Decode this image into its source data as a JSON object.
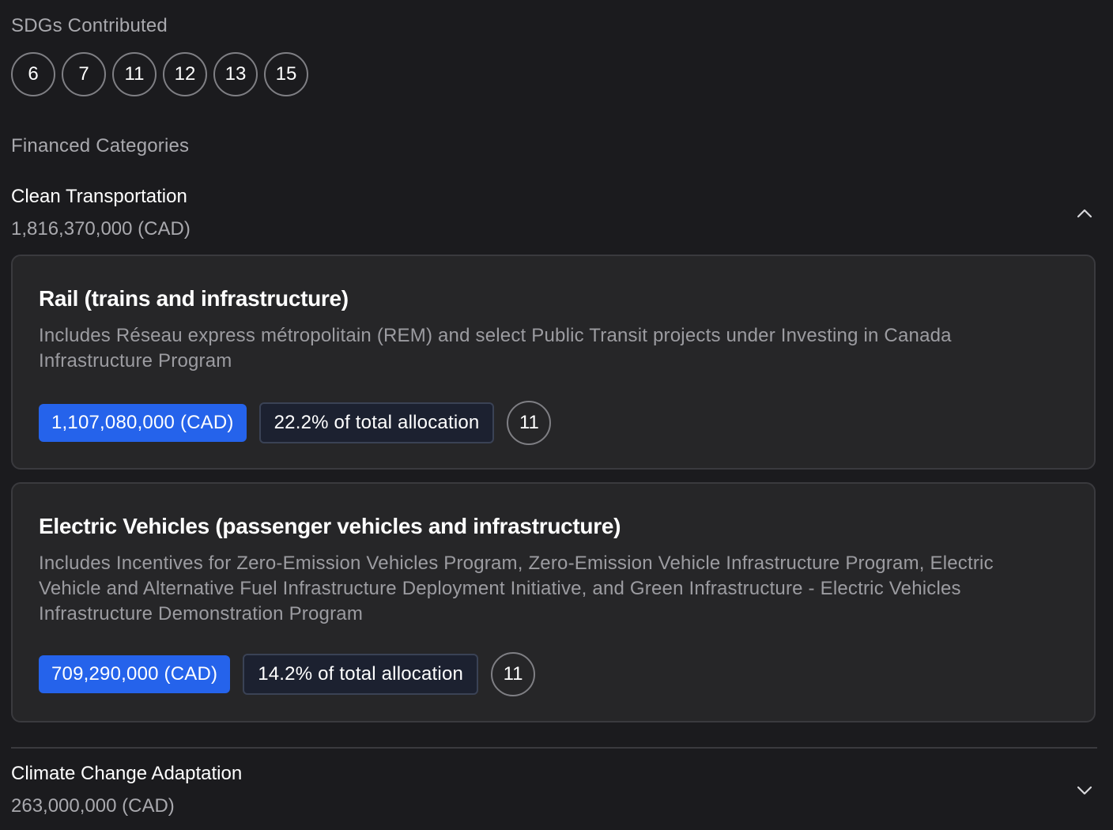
{
  "sdgs": {
    "label": "SDGs Contributed",
    "items": [
      "6",
      "7",
      "11",
      "12",
      "13",
      "15"
    ]
  },
  "financed": {
    "label": "Financed Categories",
    "categories": [
      {
        "title": "Clean Transportation",
        "amount": "1,816,370,000 (CAD)",
        "expanded": true,
        "projects": [
          {
            "title": "Rail (trains and infrastructure)",
            "description": "Includes Réseau express métropolitain (REM) and select Public Transit projects under Investing in Canada Infrastructure Program",
            "amount": "1,107,080,000 (CAD)",
            "allocation": "22.2% of total allocation",
            "sdg": "11"
          },
          {
            "title": "Electric Vehicles (passenger vehicles and infrastructure)",
            "description": "Includes Incentives for Zero-Emission Vehicles Program, Zero-Emission Vehicle Infrastructure Program, Electric Vehicle and Alternative Fuel Infrastructure Deployment Initiative, and Green Infrastructure - Electric Vehicles Infrastructure Demonstration Program",
            "amount": "709,290,000 (CAD)",
            "allocation": "14.2% of total allocation",
            "sdg": "11"
          }
        ]
      },
      {
        "title": "Climate Change Adaptation",
        "amount": "263,000,000 (CAD)",
        "expanded": false
      }
    ]
  },
  "icons": {
    "expanded": "chevron-up-icon",
    "collapsed": "chevron-down-icon"
  },
  "colors": {
    "background": "#1b1b1e",
    "card": "#262628",
    "amount_chip": "#2563eb",
    "allocation_chip": "#1c2130"
  }
}
